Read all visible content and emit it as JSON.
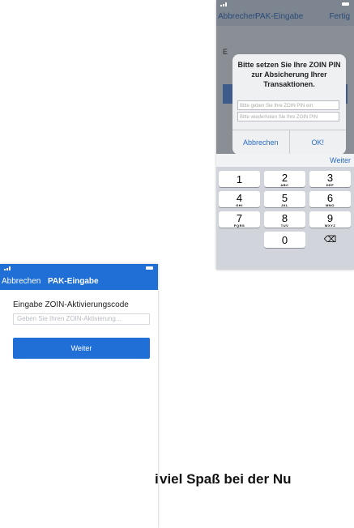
{
  "pin_screen": {
    "nav": {
      "left": "Abbrechen",
      "title": "PAK-Eingabe",
      "right": "Fertig"
    },
    "background_char": "E",
    "dialog": {
      "message": "Bitte setzen Sie Ihre ZOIN PIN zur Absicherung Ihrer Transaktionen.",
      "pin_placeholder": "Bitte geben Sie Ihre ZOIN PIN ein",
      "pin_repeat_placeholder": "Bitte wiederholen Sie Ihre ZOIN PIN",
      "cancel": "Abbrechen",
      "ok": "OK!"
    },
    "accessory": "Weiter",
    "keypad": [
      {
        "digit": "1",
        "letters": ""
      },
      {
        "digit": "2",
        "letters": "ABC"
      },
      {
        "digit": "3",
        "letters": "DEF"
      },
      {
        "digit": "4",
        "letters": "GHI"
      },
      {
        "digit": "5",
        "letters": "JKL"
      },
      {
        "digit": "6",
        "letters": "MNO"
      },
      {
        "digit": "7",
        "letters": "PQRS"
      },
      {
        "digit": "8",
        "letters": "TUV"
      },
      {
        "digit": "9",
        "letters": "WXYZ"
      },
      {
        "digit": "0",
        "letters": ""
      }
    ],
    "delete_icon": "⌫"
  },
  "pak_screen": {
    "nav": {
      "left": "Abbrechen",
      "title": "PAK-Eingabe"
    },
    "label": "Eingabe ZOIN-Aktivierungscode",
    "input_placeholder": "Geben Sie Ihren ZOIN-Aktivierung...",
    "button": "Weiter"
  },
  "caption": {
    "left_fragment": "i",
    "right_fragment": "viel Spaß bei der Nu"
  },
  "colors": {
    "accent": "#1f6fd6",
    "link": "#2b6cc7"
  }
}
